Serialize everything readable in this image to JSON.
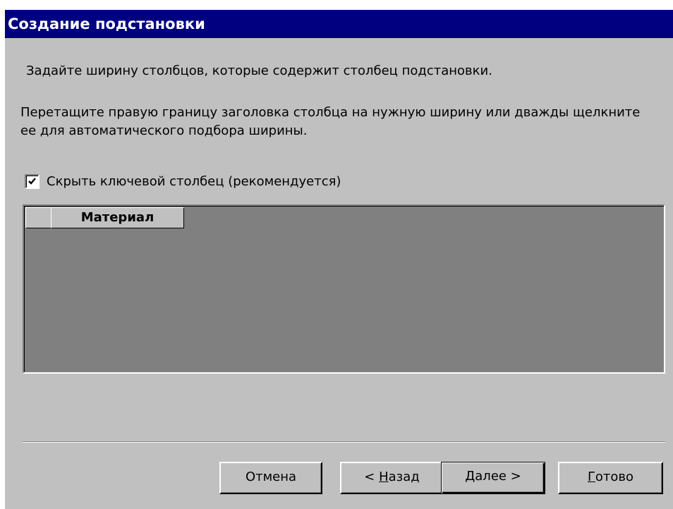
{
  "window": {
    "title": "Создание подстановки"
  },
  "instructions": {
    "line1": "Задайте ширину столбцов, которые содержит столбец подстановки.",
    "line2": "Перетащите правую границу заголовка столбца на нужную ширину или дважды щелкните ее для автоматического подбора ширины."
  },
  "options": {
    "hide_key_label": "Скрыть ключевой столбец (рекомендуется)",
    "hide_key_checked": true
  },
  "grid": {
    "columns": [
      "",
      "Материал"
    ]
  },
  "buttons": {
    "cancel": "Отмена",
    "back_prefix": "< ",
    "back_mnemonic": "Н",
    "back_rest": "азад",
    "next_mnemonic": "Д",
    "next_rest": "алее >",
    "finish_mnemonic": "Г",
    "finish_rest": "отово"
  },
  "colors": {
    "titlebar": "#000080",
    "dialog_bg": "#c0c0c0",
    "grid_bg": "#808080"
  }
}
